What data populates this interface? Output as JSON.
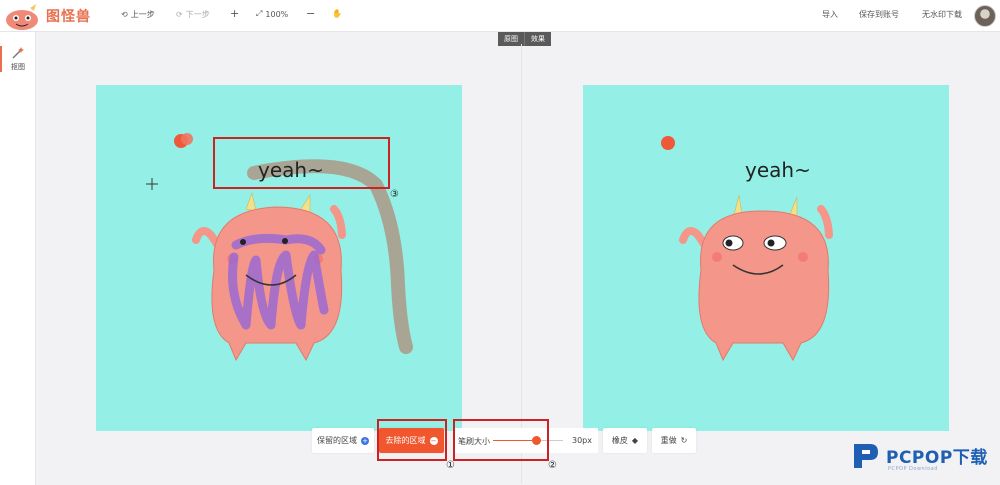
{
  "app": {
    "logo_text": "图怪兽"
  },
  "toolbar": {
    "undo": "上一步",
    "redo": "下一步",
    "zoom": "100%",
    "import": "导入",
    "save_account": "保存到账号",
    "download": "无水印下载"
  },
  "sidebar": {
    "items": [
      {
        "label": "抠图"
      }
    ]
  },
  "view_toggle": {
    "original": "原图",
    "effect": "效果"
  },
  "canvas": {
    "yeah_text": "yeah~"
  },
  "bottom_toolbar": {
    "keep_area": "保留的区域",
    "remove_area": "去除的区域",
    "brush_size_label": "笔刷大小",
    "brush_size_value": "30px",
    "brush_size_level": 0.62,
    "eraser": "橡皮",
    "redo_all": "重做"
  },
  "annotations": {
    "marker_1": "①",
    "marker_2": "②",
    "marker_3": "③"
  },
  "watermark": {
    "brand": "PCPOP下载",
    "sub": "PCPOP Download"
  },
  "colors": {
    "accent": "#f0572f",
    "canvas_bg": "#94f0e6",
    "box_red": "#cc2222",
    "monster": "#f4968a"
  }
}
